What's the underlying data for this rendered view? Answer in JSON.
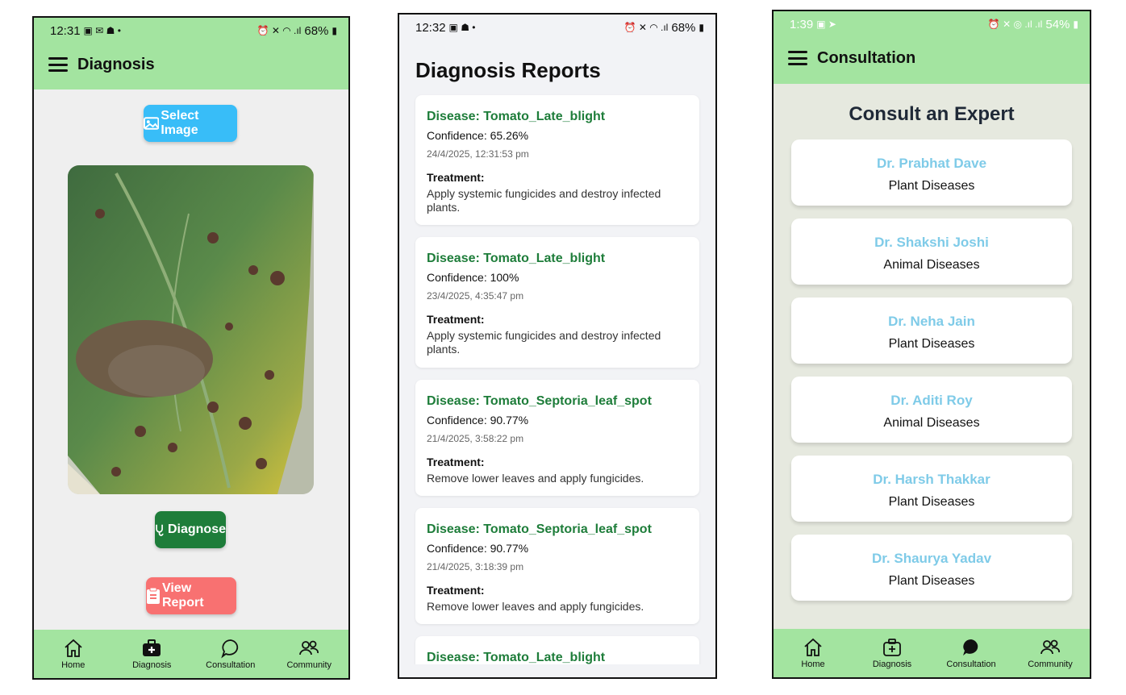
{
  "colors": {
    "header_green": "#a3e4a0",
    "select_blue": "#38bdf8",
    "diagnose_green": "#1e7d3a",
    "report_red": "#f87171",
    "disease_green": "#1e7d3a",
    "doctor_blue": "#7fcbe8"
  },
  "nav": {
    "home": "Home",
    "diagnosis": "Diagnosis",
    "consultation": "Consultation",
    "community": "Community"
  },
  "screen1": {
    "status": {
      "time": "12:31",
      "battery": "68%"
    },
    "title": "Diagnosis",
    "select_image_label": "Select Image",
    "diagnose_label": "Diagnose",
    "view_report_label": "View Report"
  },
  "screen2": {
    "status": {
      "time": "12:32",
      "battery": "68%"
    },
    "title": "Diagnosis Reports",
    "treatment_label": "Treatment:",
    "reports": [
      {
        "disease": "Disease: Tomato_Late_blight",
        "confidence": "Confidence: 65.26%",
        "date": "24/4/2025, 12:31:53 pm",
        "treatment": "Apply systemic fungicides and destroy infected plants."
      },
      {
        "disease": "Disease: Tomato_Late_blight",
        "confidence": "Confidence: 100%",
        "date": "23/4/2025, 4:35:47 pm",
        "treatment": "Apply systemic fungicides and destroy infected plants."
      },
      {
        "disease": "Disease: Tomato_Septoria_leaf_spot",
        "confidence": "Confidence: 90.77%",
        "date": "21/4/2025, 3:58:22 pm",
        "treatment": "Remove lower leaves and apply fungicides."
      },
      {
        "disease": "Disease: Tomato_Septoria_leaf_spot",
        "confidence": "Confidence: 90.77%",
        "date": "21/4/2025, 3:18:39 pm",
        "treatment": "Remove lower leaves and apply fungicides."
      },
      {
        "disease": "Disease: Tomato_Late_blight"
      }
    ]
  },
  "screen3": {
    "status": {
      "time": "1:39",
      "battery": "54%"
    },
    "title": "Consultation",
    "heading": "Consult an Expert",
    "doctors": [
      {
        "name": "Dr. Prabhat Dave",
        "specialty": "Plant Diseases"
      },
      {
        "name": "Dr. Shakshi Joshi",
        "specialty": "Animal Diseases"
      },
      {
        "name": "Dr. Neha Jain",
        "specialty": "Plant Diseases"
      },
      {
        "name": "Dr. Aditi Roy",
        "specialty": "Animal Diseases"
      },
      {
        "name": "Dr. Harsh Thakkar",
        "specialty": "Plant Diseases"
      },
      {
        "name": "Dr. Shaurya Yadav",
        "specialty": "Plant Diseases"
      }
    ]
  }
}
